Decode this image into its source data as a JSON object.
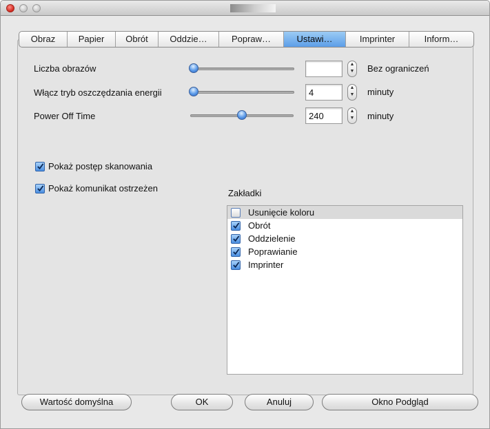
{
  "tabs": [
    {
      "label": "Obraz"
    },
    {
      "label": "Papier"
    },
    {
      "label": "Obrót"
    },
    {
      "label": "Oddzie…"
    },
    {
      "label": "Popraw…"
    },
    {
      "label": "Ustawi…"
    },
    {
      "label": "Imprinter"
    },
    {
      "label": "Inform…"
    }
  ],
  "active_tab": "Ustawi…",
  "settings": {
    "image_count": {
      "label": "Liczba obrazów",
      "value": "",
      "unit": "Bez ograniczeń",
      "slider_fraction": 0.0
    },
    "energy_saving": {
      "label": "Włącz tryb oszczędzania energii",
      "value": "4",
      "unit": "minuty",
      "slider_fraction": 0.0
    },
    "power_off": {
      "label": "Power Off Time",
      "value": "240",
      "unit": "minuty",
      "slider_fraction": 0.5
    }
  },
  "options": {
    "show_progress": {
      "label": "Pokaż postęp skanowania",
      "checked": true
    },
    "show_warning": {
      "label": "Pokaż komunikat ostrzeżen",
      "checked": true
    }
  },
  "bookmarks": {
    "title": "Zakładki",
    "items": [
      {
        "label": "Usunięcie koloru",
        "checked": false
      },
      {
        "label": "Obrót",
        "checked": true
      },
      {
        "label": "Oddzielenie",
        "checked": true
      },
      {
        "label": "Poprawianie",
        "checked": true
      },
      {
        "label": "Imprinter",
        "checked": true
      }
    ]
  },
  "buttons": {
    "default": "Wartość domyślna",
    "ok": "OK",
    "cancel": "Anuluj",
    "preview": "Okno Podgląd"
  },
  "colors": {
    "accent": "#5c9ee8",
    "window_bg": "#e8e8e8"
  }
}
